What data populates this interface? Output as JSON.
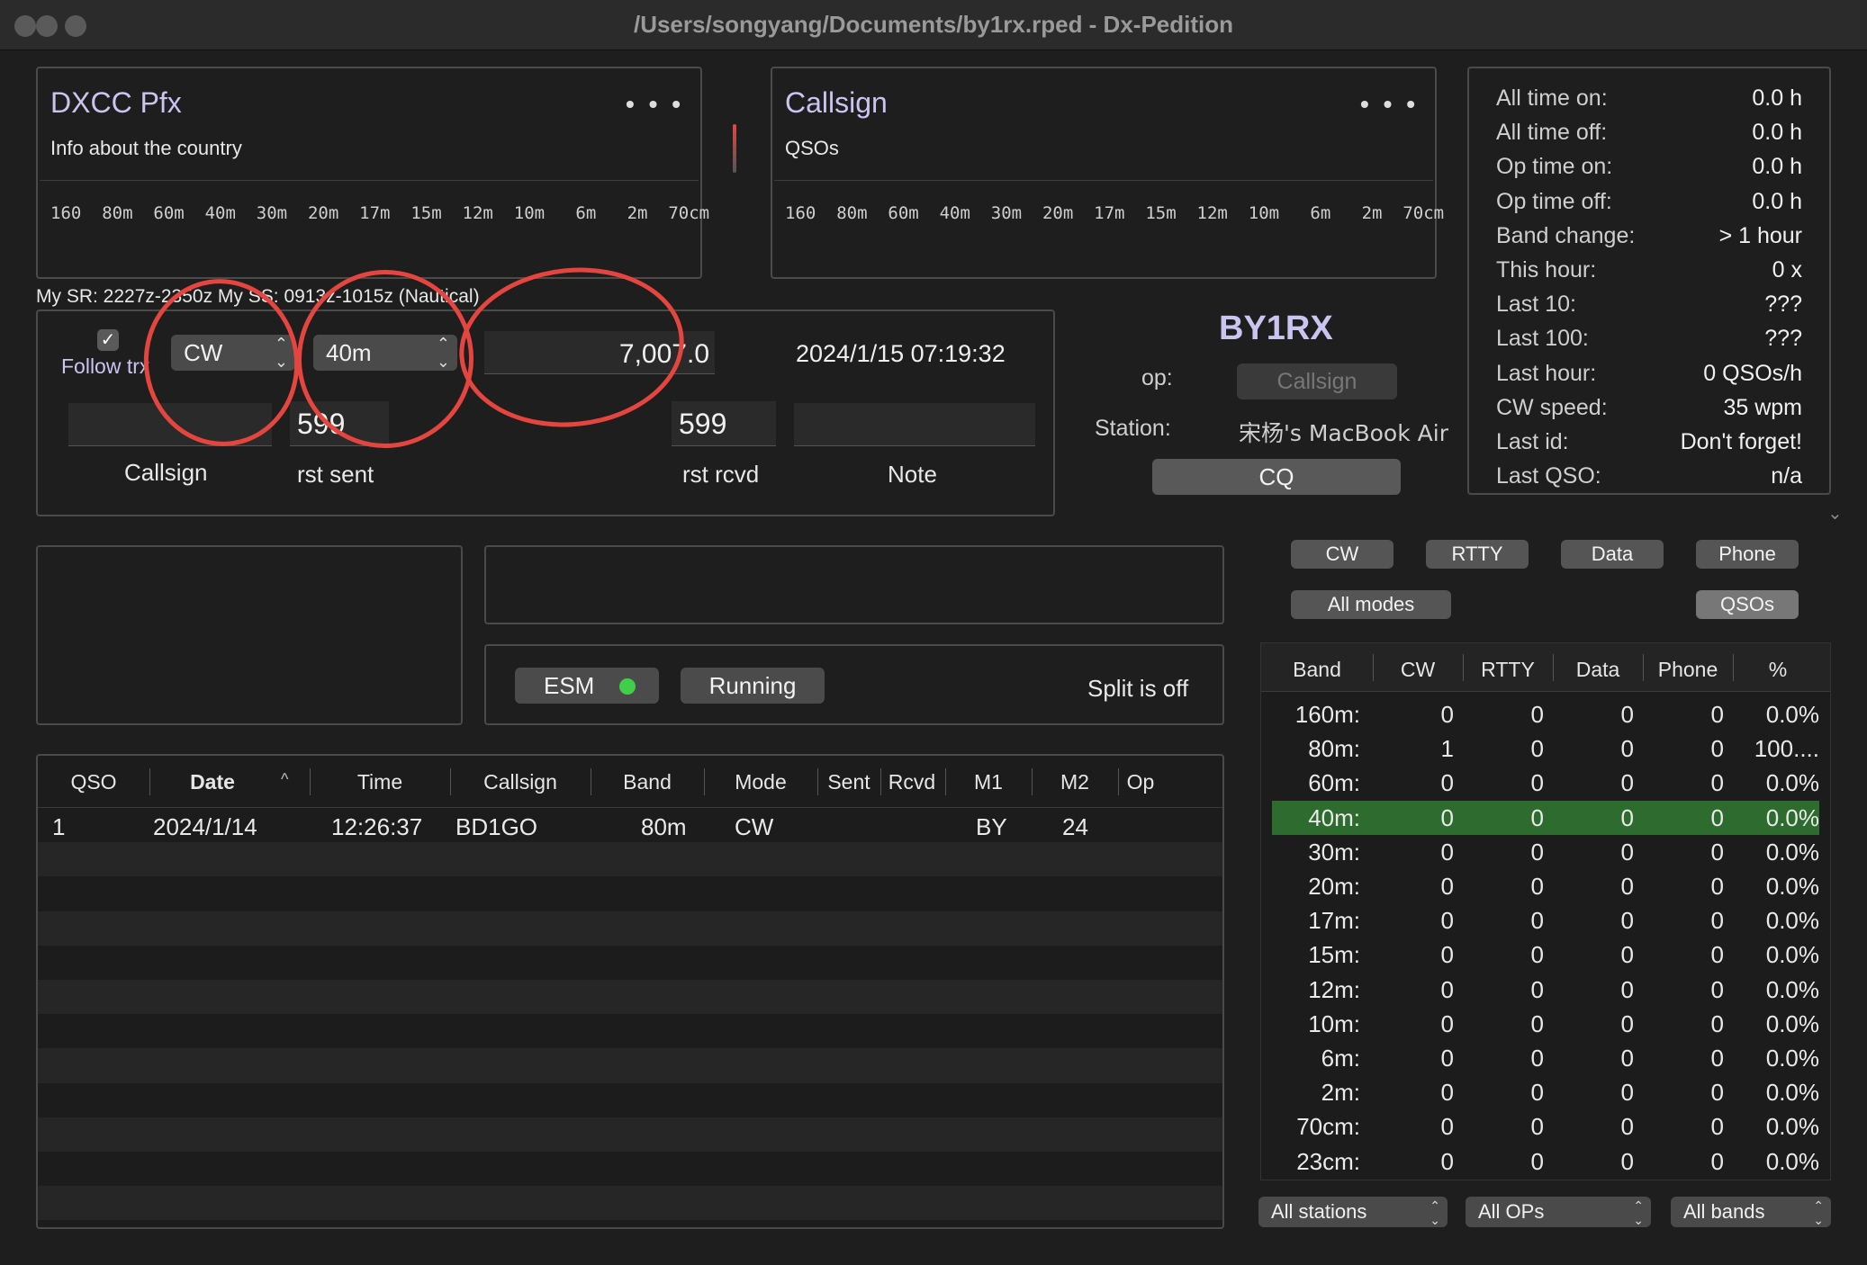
{
  "window": {
    "title": "/Users/songyang/Documents/by1rx.rped - Dx-Pedition"
  },
  "dxcc_panel": {
    "title": "DXCC Pfx",
    "subtitle": "Info about the country",
    "menu": "• • •",
    "bands": "160  80m  60m  40m  30m  20m  17m  15m  12m  10m   6m   2m  70cm"
  },
  "call_panel": {
    "title": "Callsign",
    "subtitle": "QSOs",
    "menu": "• • •",
    "bands": "160  80m  60m  40m  30m  20m  17m  15m  12m  10m   6m   2m  70cm"
  },
  "sun_info": "My SR: 2227z-2350z  My SS: 0913z-1015z (Nautical)",
  "entry": {
    "follow_trx_label": "Follow trx",
    "follow_trx_checked": true,
    "mode": "CW",
    "band": "40m",
    "frequency": "7,007.0",
    "datetime": "2024/1/15   07:19:32",
    "callsign_value": "",
    "rst_sent": "599",
    "rst_rcvd": "599",
    "note_value": "",
    "callsign_label": "Callsign",
    "rst_sent_label": "rst sent",
    "rst_rcvd_label": "rst rcvd",
    "note_label": "Note"
  },
  "station": {
    "my_call": "BY1RX",
    "op_label": "op:",
    "op_placeholder": "Callsign",
    "station_label": "Station:",
    "station_value": "宋杨's MacBook Air",
    "cq_button": "CQ"
  },
  "stats": [
    {
      "k": "All time on:",
      "v": "0.0 h"
    },
    {
      "k": "All time off:",
      "v": "0.0 h"
    },
    {
      "k": "Op time on:",
      "v": "0.0 h"
    },
    {
      "k": "Op time off:",
      "v": "0.0 h"
    },
    {
      "k": "Band change:",
      "v": "> 1 hour"
    },
    {
      "k": "This hour:",
      "v": "0 x"
    },
    {
      "k": "Last 10:",
      "v": "???"
    },
    {
      "k": "Last 100:",
      "v": "???"
    },
    {
      "k": "Last hour:",
      "v": "0 QSOs/h"
    },
    {
      "k": "CW speed:",
      "v": "35 wpm"
    },
    {
      "k": "Last id:",
      "v": "Don't forget!"
    },
    {
      "k": "Last QSO:",
      "v": "n/a"
    }
  ],
  "status": {
    "esm_label": "ESM",
    "esm_color": "#3fcf4a",
    "running_label": "Running",
    "split_text": "Split is off"
  },
  "mode_filters": {
    "cw": "CW",
    "rtty": "RTTY",
    "data": "Data",
    "phone": "Phone",
    "all_modes": "All modes",
    "qsos": "QSOs"
  },
  "log": {
    "columns": [
      "QSO",
      "Date",
      "Time",
      "Callsign",
      "Band",
      "Mode",
      "Sent",
      "Rcvd",
      "M1",
      "M2",
      "Op"
    ],
    "rows": [
      {
        "qso": "1",
        "date": "2024/1/14",
        "time": "12:26:37",
        "callsign": "BD1GO",
        "band": "80m",
        "mode": "CW",
        "sent": "",
        "rcvd": "",
        "m1": "BY",
        "m2": "24",
        "op": ""
      }
    ]
  },
  "band_table": {
    "columns": [
      "Band",
      "CW",
      "RTTY",
      "Data",
      "Phone",
      "%"
    ],
    "highlight_color": "#2e6b2e",
    "rows": [
      [
        "160m:",
        "0",
        "0",
        "0",
        "0",
        "0.0%"
      ],
      [
        "80m:",
        "1",
        "0",
        "0",
        "0",
        "100...."
      ],
      [
        "60m:",
        "0",
        "0",
        "0",
        "0",
        "0.0%"
      ],
      [
        "40m:",
        "0",
        "0",
        "0",
        "0",
        "0.0%"
      ],
      [
        "30m:",
        "0",
        "0",
        "0",
        "0",
        "0.0%"
      ],
      [
        "20m:",
        "0",
        "0",
        "0",
        "0",
        "0.0%"
      ],
      [
        "17m:",
        "0",
        "0",
        "0",
        "0",
        "0.0%"
      ],
      [
        "15m:",
        "0",
        "0",
        "0",
        "0",
        "0.0%"
      ],
      [
        "12m:",
        "0",
        "0",
        "0",
        "0",
        "0.0%"
      ],
      [
        "10m:",
        "0",
        "0",
        "0",
        "0",
        "0.0%"
      ],
      [
        "6m:",
        "0",
        "0",
        "0",
        "0",
        "0.0%"
      ],
      [
        "2m:",
        "0",
        "0",
        "0",
        "0",
        "0.0%"
      ],
      [
        "70cm:",
        "0",
        "0",
        "0",
        "0",
        "0.0%"
      ],
      [
        "23cm:",
        "0",
        "0",
        "0",
        "0",
        "0.0%"
      ]
    ],
    "highlight_row": 3
  },
  "bottom_filters": {
    "stations": "All stations",
    "ops": "All OPs",
    "bands": "All bands"
  },
  "annotation_color": "#e5453f"
}
